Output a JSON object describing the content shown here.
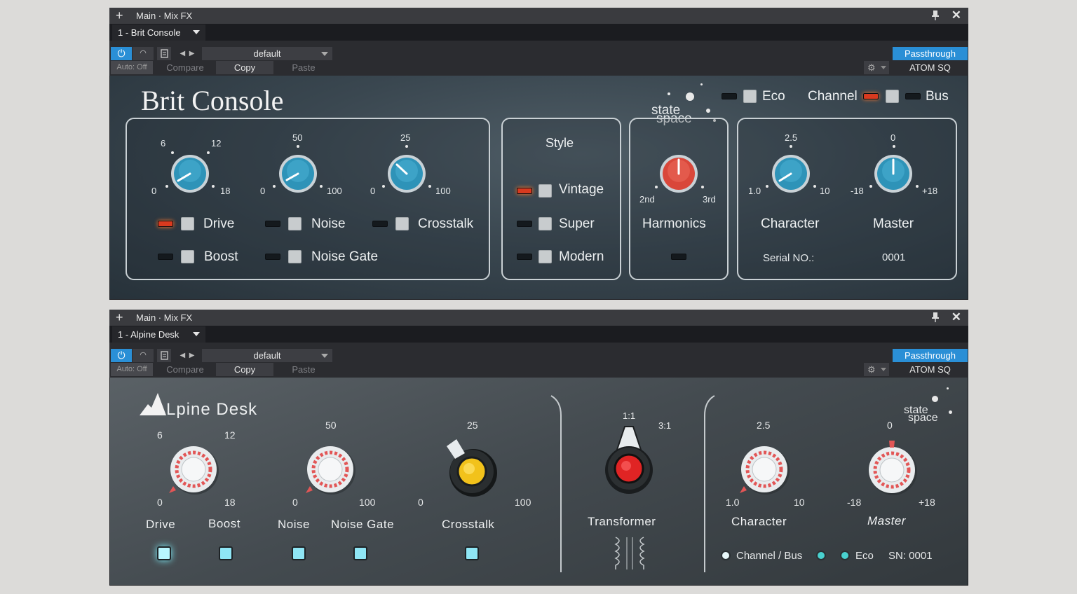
{
  "windows": [
    {
      "title": "Main · Mix FX",
      "instance": "1 - Brit Console",
      "preset": "default",
      "auto": "Auto: Off",
      "compare": "Compare",
      "copy": "Copy",
      "paste": "Paste",
      "passthrough": "Passthrough",
      "device": "ATOM SQ"
    },
    {
      "title": "Main · Mix FX",
      "instance": "1 - Alpine Desk",
      "preset": "default",
      "auto": "Auto: Off",
      "compare": "Compare",
      "copy": "Copy",
      "paste": "Paste",
      "passthrough": "Passthrough",
      "device": "ATOM SQ"
    }
  ],
  "brit": {
    "title": "Brit Console",
    "logo": [
      "state",
      "space"
    ],
    "eco": "Eco",
    "channel": "Channel",
    "bus": "Bus",
    "drive_scale": [
      "6",
      "12",
      "0",
      "18"
    ],
    "noise_scale": [
      "50",
      "0",
      "100"
    ],
    "crosstalk_scale": [
      "25",
      "0",
      "100"
    ],
    "drive": "Drive",
    "boost": "Boost",
    "noise": "Noise",
    "noise_gate": "Noise Gate",
    "crosstalk": "Crosstalk",
    "style": "Style",
    "vintage": "Vintage",
    "super": "Super",
    "modern": "Modern",
    "harm_scale": [
      "2nd",
      "3rd"
    ],
    "harmonics": "Harmonics",
    "char_scale": [
      "2.5",
      "1.0",
      "10"
    ],
    "master_scale": [
      "0",
      "-18",
      "+18"
    ],
    "character": "Character",
    "master": "Master",
    "serial_label": "Serial NO.:",
    "serial": "0001",
    "states": {
      "drive": true,
      "boost": false,
      "noise": false,
      "noise_gate": false,
      "crosstalk": false,
      "vintage": true,
      "super": false,
      "modern": false,
      "harmonics": false,
      "eco": false,
      "channel": true,
      "bus": false
    },
    "colors": {
      "knob_blue": "#2e93b8",
      "knob_red": "#d9473a",
      "led_on": "#d83a1f"
    }
  },
  "alpine": {
    "title": "Lpine Desk",
    "logo": [
      "state",
      "space"
    ],
    "drive_scale": [
      "6",
      "12",
      "0",
      "18"
    ],
    "noise_scale": [
      "50",
      "0",
      "100"
    ],
    "crosstalk_scale": [
      "25",
      "0",
      "100"
    ],
    "trans_scale": [
      "1:1",
      "3:1"
    ],
    "char_scale": [
      "2.5",
      "1.0",
      "10"
    ],
    "master_scale": [
      "0",
      "-18",
      "+18"
    ],
    "drive": "Drive",
    "boost": "Boost",
    "noise": "Noise",
    "noise_gate": "Noise Gate",
    "crosstalk": "Crosstalk",
    "transformer": "Transformer",
    "character": "Character",
    "master": "Master",
    "channel_bus": "Channel / Bus",
    "eco": "Eco",
    "sn": "SN:  0001",
    "colors": {
      "accent": "#8fe6f5",
      "crosstalk_cap": "#f2c21b",
      "transformer_cap": "#e02424"
    }
  }
}
